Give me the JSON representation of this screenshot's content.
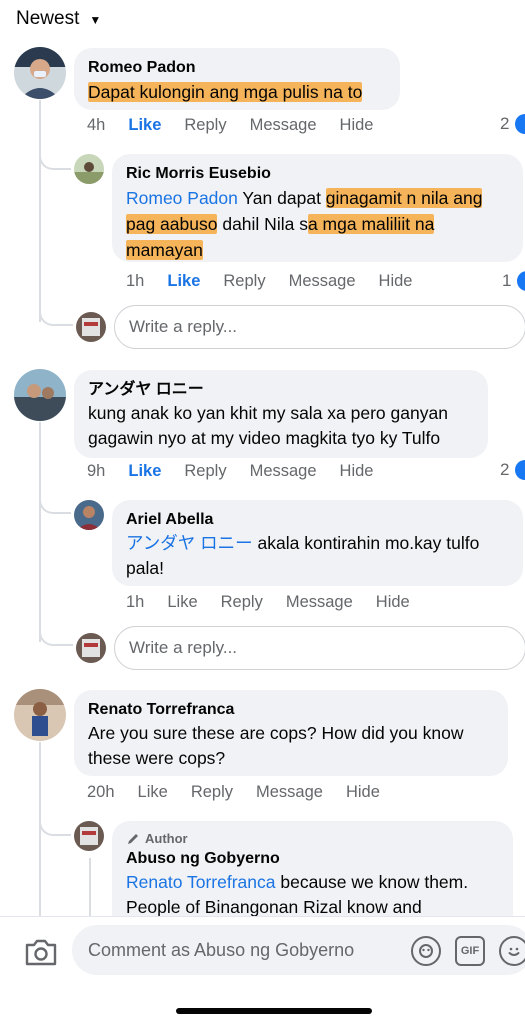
{
  "sort": {
    "label": "Newest"
  },
  "comments": [
    {
      "name": "Romeo Padon",
      "text_hl": "Dapat kulongin ang mga pulis na to",
      "time": "4h",
      "reaction_count": "2",
      "replies": [
        {
          "name": "Ric Morris Eusebio",
          "mention": "Romeo Padon",
          "text_1": " Yan dapat ",
          "hl_1": "ginagamit n nila ang",
          "hl_2": "pag aabuso",
          "text_2": " dahil Nila s",
          "hl_3": "a mga maliliit na",
          "hl_4": "mamayan",
          "time": "1h",
          "reaction_count": "1"
        }
      ]
    },
    {
      "name": "アンダヤ ロニー",
      "text": "kung anak ko yan khit my sala xa pero ganyan gagawin nyo at my video magkita tyo ky Tulfo",
      "time": "9h",
      "reaction_count": "2",
      "replies": [
        {
          "name": "Ariel Abella",
          "mention": "アンダヤ ロニー",
          "text": " akala kontirahin mo.kay tulfo pala!",
          "time": "1h"
        }
      ]
    },
    {
      "name": "Renato Torrefranca",
      "text": "Are you sure these are cops? How did you know these were cops?",
      "time": "20h",
      "replies": [
        {
          "badge": "Author",
          "name": "Abuso ng Gobyerno",
          "mention": "Renato Torrefranca",
          "text": " because we know them. People of Binangonan Rizal know and"
        }
      ]
    }
  ],
  "actions": {
    "like": "Like",
    "reply": "Reply",
    "message": "Message",
    "hide": "Hide"
  },
  "reply_box": {
    "placeholder": "Write a reply..."
  },
  "composer": {
    "placeholder": "Comment as Abuso ng Gobyerno"
  },
  "icons": {
    "camera": "camera-icon",
    "avatar_sticker": "avatar-sticker-icon",
    "gif": "GIF",
    "emoji": "emoji-icon"
  },
  "colors": {
    "accent": "#1b74e4",
    "highlight": "#f5b45a",
    "bubble": "#f0f2f5",
    "muted": "#65676b"
  }
}
